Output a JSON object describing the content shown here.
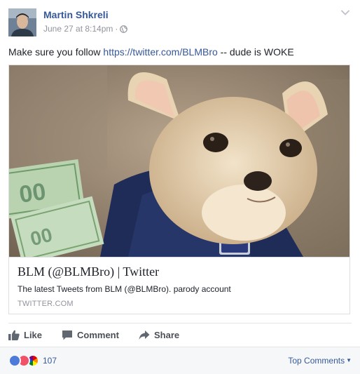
{
  "post": {
    "author": "Martin Shkreli",
    "timestamp": "June 27 at 8:14pm",
    "separator": "·",
    "privacy_icon": "globe-icon",
    "text_before": "Make sure you follow ",
    "text_link": "https://twitter.com/BLMBro",
    "text_after": " -- dude is WOKE"
  },
  "link_card": {
    "title": "BLM (@BLMBro) | Twitter",
    "description": "The latest Tweets from BLM (@BLMBro). parody account",
    "domain": "TWITTER.COM"
  },
  "actions": {
    "like": "Like",
    "comment": "Comment",
    "share": "Share"
  },
  "footer": {
    "reaction_count": "107",
    "top_comments": "Top Comments"
  },
  "colors": {
    "link": "#365899",
    "meta": "#90949c",
    "action_text": "#4b4f56",
    "footer_bg": "#f6f7f9"
  }
}
